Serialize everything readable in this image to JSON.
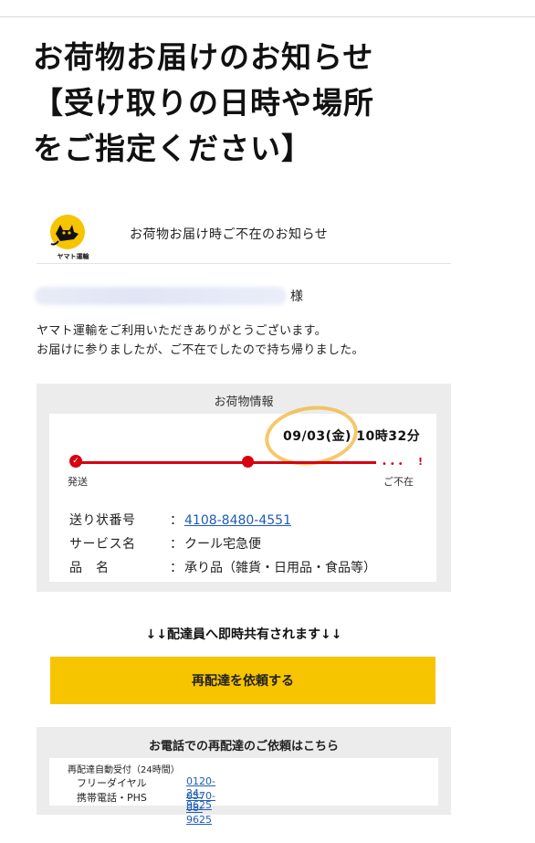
{
  "title": {
    "line1": "お荷物お届けのお知らせ",
    "line2": "【受け取りの日時や場所",
    "line3": "をご指定ください】"
  },
  "header": {
    "logo_text": "ヤマト運輸",
    "title": "お荷物お届け時ご不在のお知らせ"
  },
  "recipient": {
    "honorific": "様"
  },
  "message": {
    "line1": "ヤマト運輸をご利用いただきありがとうございます。",
    "line2": "お届けに参りましたが、ご不在でしたので持ち帰りました。"
  },
  "package_info": {
    "heading": "お荷物情報",
    "datetime": "09/03(金) 10時32分",
    "status_start": "発送",
    "status_end": "ご不在",
    "rows": [
      {
        "key": "送り状番号",
        "value": "4108-8480-4551"
      },
      {
        "key": "サービス名",
        "value": "クール宅急便"
      },
      {
        "key": "品　名",
        "value": "承り品（雑貨・日用品・食品等）"
      }
    ]
  },
  "share_notice": "↓↓配達員へ即時共有されます↓↓",
  "redeliver_button": "再配達を依頼する",
  "phone": {
    "heading": "お電話での再配達のご依頼はこちら",
    "sub": "再配達自動受付（24時間）",
    "free_label": "フリーダイヤル",
    "free_number": "0120-24-9625",
    "mobile_label": "携帯電話・PHS",
    "mobile_number": "0570-08-9625"
  },
  "colors": {
    "brand_yellow": "#f7c400",
    "status_red": "#d7000f",
    "link_blue": "#1e5bb5",
    "annotation_orange": "#f3b63a"
  }
}
